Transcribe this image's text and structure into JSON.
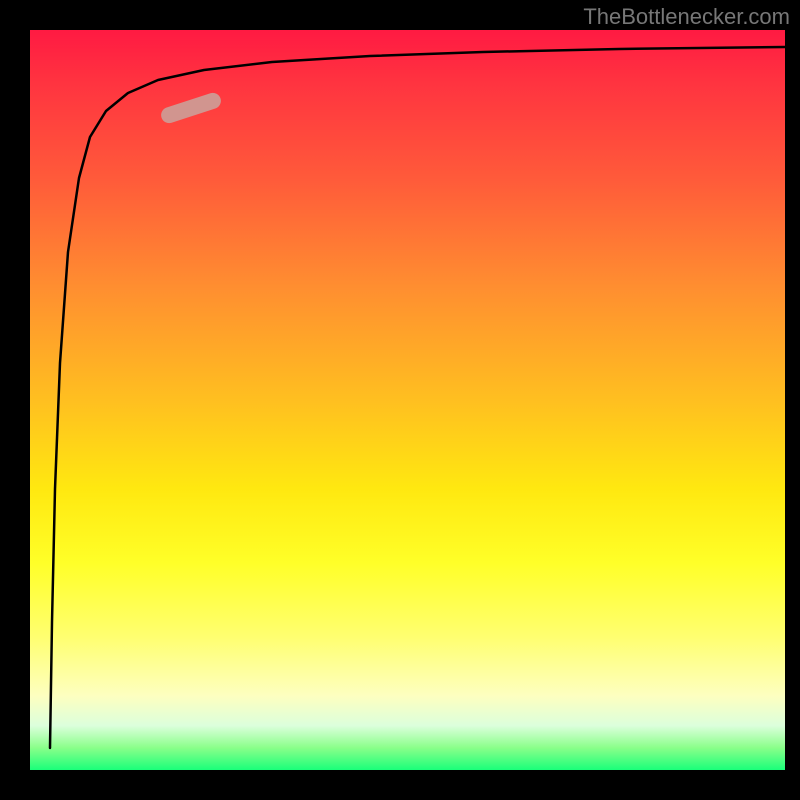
{
  "watermark": "TheBottlenecker.com",
  "chart_data": {
    "type": "line",
    "title": "",
    "xlabel": "",
    "ylabel": "",
    "xlim": [
      0,
      100
    ],
    "ylim": [
      -100,
      0
    ],
    "description": "Single curve rising from bottom-left, sweeping sharply toward top-left then flattening near top edge, over a vertical red-to-green gradient background. A pink pill highlight sits on the upper-left portion of the curve.",
    "series": [
      {
        "name": "curve",
        "x": [
          2.6,
          2.9,
          3.3,
          4.0,
          5.0,
          6.5,
          8.0,
          10.0,
          13.0,
          17.0,
          23.0,
          32.0,
          45.0,
          60.0,
          78.0,
          100.0
        ],
        "y": [
          -97,
          -80,
          -62,
          -45,
          -30,
          -20,
          -14.5,
          -11.0,
          -8.5,
          -6.8,
          -5.4,
          -4.3,
          -3.5,
          -3.0,
          -2.6,
          -2.3
        ]
      }
    ],
    "highlight_segment": {
      "x_range": [
        14,
        22
      ],
      "y_range": [
        -9.5,
        -7.0
      ]
    }
  }
}
